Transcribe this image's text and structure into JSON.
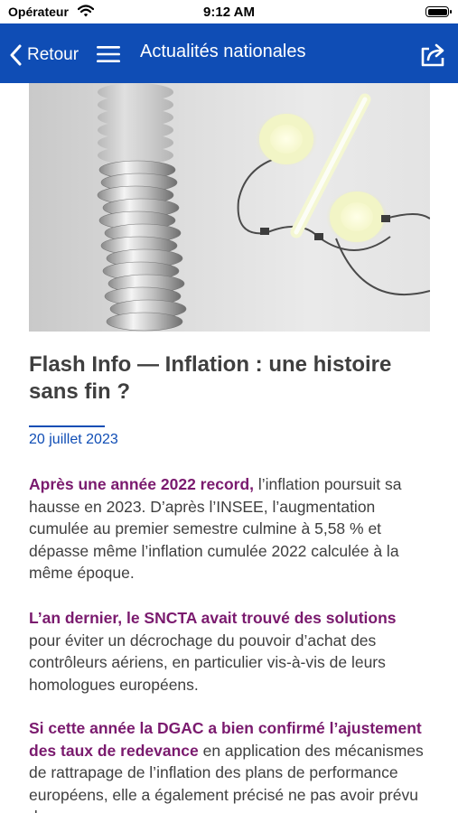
{
  "status_bar": {
    "carrier": "Opérateur",
    "time": "9:12 AM"
  },
  "nav": {
    "back_label": "Retour",
    "title": "Actualités nationales",
    "color": "#0f4db5"
  },
  "article": {
    "title": "Flash Info — Inflation : une histoire sans fin ?",
    "date": "20 juillet 2023",
    "highlight_color": "#7a1a6e",
    "paragraphs": [
      {
        "highlight": "Après une année 2022 record,",
        "text": " l’inflation poursuit sa hausse en 2023. D’après l’INSEE, l’augmentation cumulée au premier semestre culmine à 5,58 % et dépasse même l’inflation cumulée 2022 calculée à la même époque."
      },
      {
        "highlight": "L’an dernier, le SNCTA avait trouvé des solutions",
        "text": " pour éviter un décrochage du pouvoir d’achat des contrôleurs aériens, en particulier vis-à-vis de leurs homologues européens."
      },
      {
        "highlight": "Si cette année la DGAC a bien confirmé l’ajustement des taux de redevance",
        "text": " en application des mécanismes de rattrapage de l’inflation des plans de performance européens, elle a également précisé ne pas avoir prévu de"
      }
    ]
  }
}
